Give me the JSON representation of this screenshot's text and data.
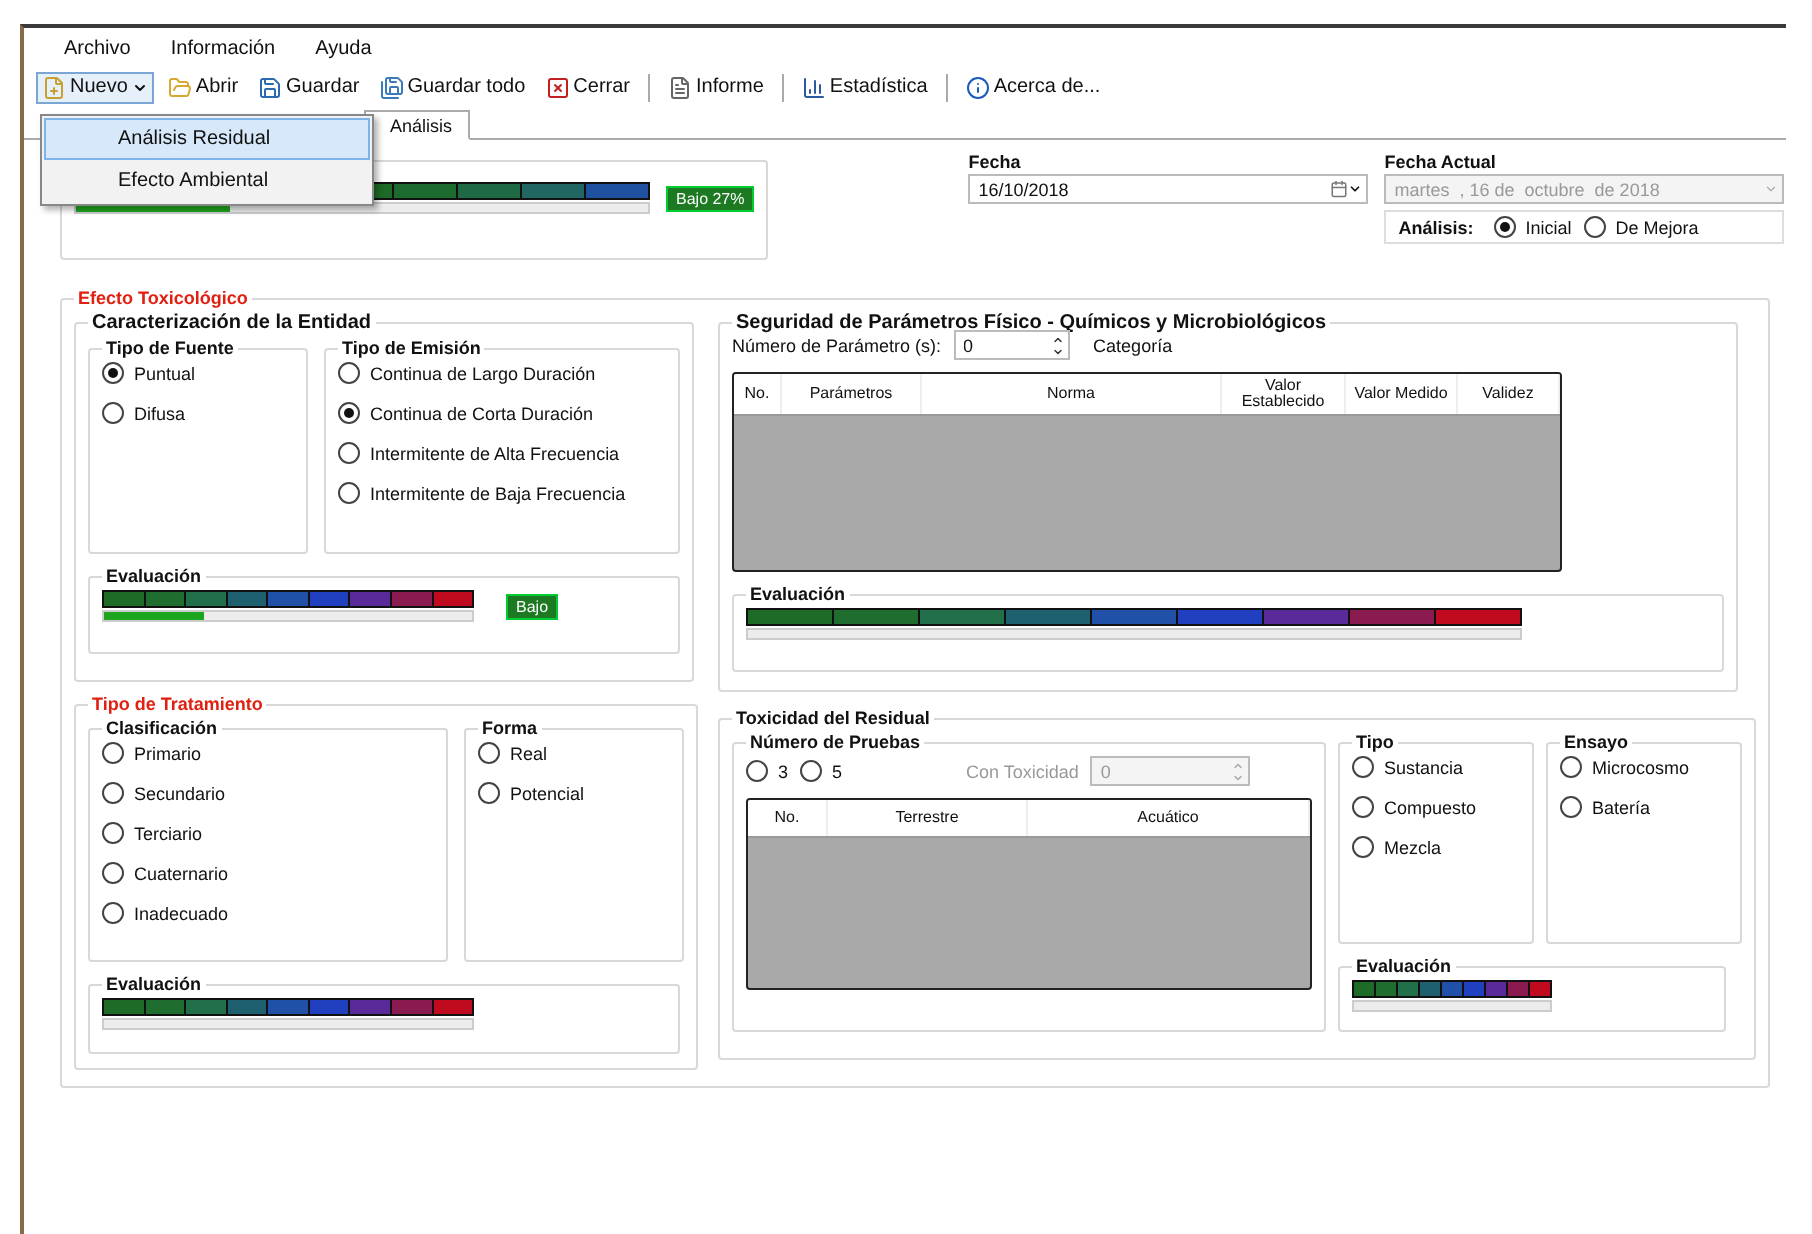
{
  "menu": [
    {
      "label": "Archivo"
    },
    {
      "label": "Información"
    },
    {
      "label": "Ayuda"
    }
  ],
  "toolbar": [
    {
      "kind": "dropdown",
      "label": "Nuevo"
    },
    {
      "kind": "button",
      "label": "Abrir"
    },
    {
      "kind": "button",
      "label": "Guardar"
    },
    {
      "kind": "button",
      "label": "Guardar todo"
    },
    {
      "kind": "button",
      "label": "Cerrar"
    },
    {
      "kind": "separator"
    },
    {
      "kind": "button",
      "label": "Informe"
    },
    {
      "kind": "separator"
    },
    {
      "kind": "button",
      "label": "Estadística"
    },
    {
      "kind": "separator"
    },
    {
      "kind": "button",
      "label": "Acerca de..."
    }
  ],
  "new_menu": {
    "open": true,
    "items": [
      {
        "label": "Análisis Residual",
        "selected": true
      },
      {
        "label": "Efecto Ambiental",
        "selected": false
      }
    ]
  },
  "tabs": [
    {
      "label": "Análisis",
      "selected": true
    }
  ],
  "summary": {
    "level": 0.27,
    "badge": "Bajo 27%"
  },
  "fecha": {
    "label": "Fecha",
    "value": "16/10/2018"
  },
  "fecha_actual": {
    "label": "Fecha Actual",
    "value": "martes  , 16 de  octubre  de 2018",
    "disabled": true
  },
  "analisis": {
    "label": "Análisis:",
    "options": [
      {
        "label": "Inicial",
        "selected": true
      },
      {
        "label": "De Mejora",
        "selected": false
      }
    ]
  },
  "efecto": {
    "title": "Efecto Toxicológico",
    "caracterizacion": {
      "title": "Caracterización de la Entidad",
      "fuente": {
        "title": "Tipo de Fuente",
        "options": [
          {
            "label": "Puntual",
            "selected": true
          },
          {
            "label": "Difusa",
            "selected": false
          }
        ]
      },
      "emision": {
        "title": "Tipo de Emisión",
        "options": [
          {
            "label": "Continua de Largo Duración",
            "selected": false
          },
          {
            "label": "Continua de Corta Duración",
            "selected": true
          },
          {
            "label": "Intermitente de Alta Frecuencia",
            "selected": false
          },
          {
            "label": "Intermitente de Baja Frecuencia",
            "selected": false
          }
        ]
      },
      "evaluacion": {
        "title": "Evaluación",
        "level": 0.27,
        "badge": "Bajo"
      }
    },
    "seguridad": {
      "title": "Seguridad de Parámetros Físico - Químicos y Microbiológicos",
      "count_label": "Número de Parámetro (s):",
      "count": "0",
      "category_label": "Categoría",
      "columns": [
        "No.",
        "Parámetros",
        "Norma",
        "Valor Establecido",
        "Valor Medido",
        "Validez"
      ],
      "evaluacion": {
        "title": "Evaluación",
        "level": 0
      }
    },
    "tratamiento": {
      "title": "Tipo de Tratamiento",
      "clasificacion": {
        "title": "Clasificación",
        "options": [
          {
            "label": "Primario",
            "selected": false
          },
          {
            "label": "Secundario",
            "selected": false
          },
          {
            "label": "Terciario",
            "selected": false
          },
          {
            "label": "Cuaternario",
            "selected": false
          },
          {
            "label": "Inadecuado",
            "selected": false
          }
        ]
      },
      "forma": {
        "title": "Forma",
        "options": [
          {
            "label": "Real",
            "selected": false
          },
          {
            "label": "Potencial",
            "selected": false
          }
        ]
      },
      "evaluacion": {
        "title": "Evaluación",
        "level": 0
      }
    },
    "toxicidad": {
      "title": "Toxicidad del Residual",
      "pruebas": {
        "title": "Número de Pruebas",
        "options": [
          {
            "label": "3",
            "selected": false
          },
          {
            "label": "5",
            "selected": false
          }
        ],
        "toxicity_label": "Con Toxicidad",
        "toxicity_value": "0",
        "toxicity_disabled": true,
        "columns": [
          "No.",
          "Terrestre",
          "Acuático"
        ]
      },
      "tipo": {
        "title": "Tipo",
        "options": [
          {
            "label": "Sustancia",
            "selected": false
          },
          {
            "label": "Compuesto",
            "selected": false
          },
          {
            "label": "Mezcla",
            "selected": false
          }
        ]
      },
      "ensayo": {
        "title": "Ensayo",
        "options": [
          {
            "label": "Microcosmo",
            "selected": false
          },
          {
            "label": "Batería",
            "selected": false
          }
        ]
      },
      "evaluacion": {
        "title": "Evaluación",
        "level": 0
      }
    }
  }
}
